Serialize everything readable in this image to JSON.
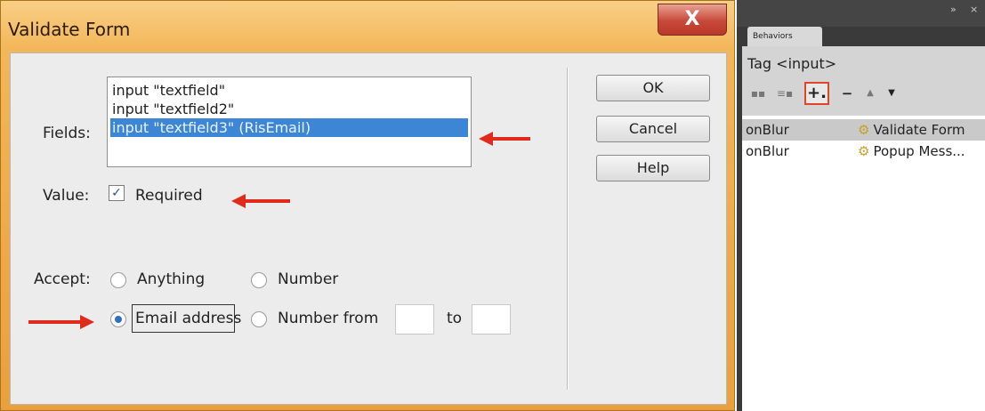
{
  "dialog": {
    "title": "Validate Form",
    "close_label": "X",
    "fields_label": "Fields:",
    "fields": [
      {
        "label": "input \"textfield\"",
        "selected": false
      },
      {
        "label": "input \"textfield2\"",
        "selected": false
      },
      {
        "label": "input \"textfield3\" (RisEmail)",
        "selected": true
      }
    ],
    "value_label": "Value:",
    "required_checked": true,
    "required_label": "Required",
    "accept_label": "Accept:",
    "options": {
      "anything": "Anything",
      "number": "Number",
      "email": "Email address",
      "number_from": "Number from",
      "to": "to"
    },
    "selected_option": "email",
    "buttons": {
      "ok": "OK",
      "cancel": "Cancel",
      "help": "Help"
    }
  },
  "panel": {
    "tab_label": "Behaviors",
    "tag_label": "Tag <input>",
    "toolbar": {
      "add": "+.",
      "remove": "−",
      "up": "▲",
      "down": "▼"
    },
    "events": [
      {
        "event": "onBlur",
        "action": "Validate Form",
        "icon": "gear-icon",
        "selected": true
      },
      {
        "event": "onBlur",
        "action": "Popup Mess...",
        "icon": "gear-icon",
        "selected": false
      }
    ]
  },
  "colors": {
    "title_bar": "#eeaa48",
    "close_button": "#c8493a",
    "selection": "#3d86d6",
    "annotation_arrow": "#e02a1c"
  }
}
